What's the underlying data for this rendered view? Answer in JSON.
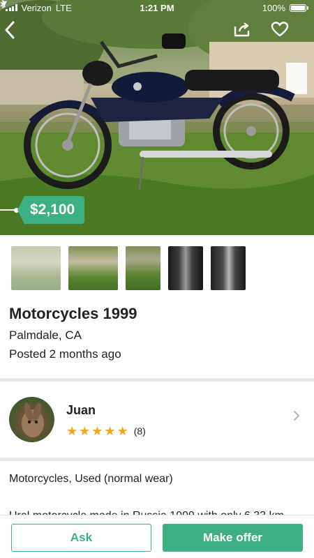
{
  "status_bar": {
    "carrier": "Verizon",
    "network": "LTE",
    "time": "1:21 PM",
    "battery": "100%"
  },
  "listing": {
    "price": "$2,100",
    "title": "Motorcycles 1999",
    "location": "Palmdale, CA",
    "posted": "Posted 2 months ago",
    "thumbnail_count": 5,
    "condition": "Motorcycles, Used (normal wear)",
    "description_preview": "Ural motorcycle made in Russia 1999 with only 6,33 km"
  },
  "seller": {
    "name": "Juan",
    "rating_stars": 5,
    "rating_count": "(8)"
  },
  "actions": {
    "ask_label": "Ask",
    "offer_label": "Make offer"
  },
  "icons": {
    "back": "back-chevron-icon",
    "share": "share-icon",
    "favorite": "heart-icon",
    "disclosure": "chevron-right-icon",
    "star": "star-icon"
  },
  "colors": {
    "accent": "#3db083",
    "star": "#f4a623",
    "divider": "#e6e6e6"
  }
}
